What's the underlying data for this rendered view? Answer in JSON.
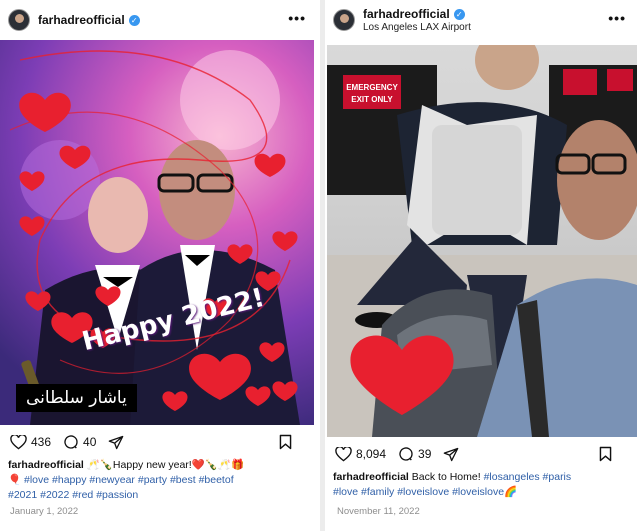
{
  "posts": [
    {
      "username": "farhadreofficial",
      "location": "",
      "banner_text": "یاشار سلطانی",
      "overlay_text": "Happy 2022!",
      "likes": "436",
      "comments": "40",
      "caption_user": "farhadreofficial",
      "caption_lines": [
        [
          "🥂🍾Happy new year!❤️🍾🥂🎁"
        ],
        [
          "🎈",
          "#love",
          "#happy",
          "#newyear",
          "#party",
          "#best",
          "#beetof"
        ],
        [
          "#2021",
          "#2022",
          "#red",
          "#passion"
        ]
      ],
      "date": "January 1, 2022"
    },
    {
      "username": "farhadreofficial",
      "location": "Los Angeles LAX Airport",
      "sign_text": [
        "EMERGENCY",
        "EXIT ONLY"
      ],
      "likes": "8,094",
      "comments": "39",
      "caption_user": "farhadreofficial",
      "caption_lines": [
        [
          "Back to Home!",
          "#losangeles",
          "#paris"
        ],
        [
          "#love",
          "#family",
          "#loveislove",
          "#loveislove🌈"
        ]
      ],
      "date": "November 11, 2022"
    }
  ],
  "icons": {
    "heart": "heart-icon",
    "comment": "comment-icon",
    "share": "share-icon",
    "bookmark": "bookmark-icon",
    "more": "more-icon",
    "verified": "verified-badge-icon"
  },
  "colors": {
    "hashtag": "#2f5fa7",
    "verified": "#3897f0",
    "heart_red": "#e8202f",
    "sign_red": "#c8102e"
  }
}
